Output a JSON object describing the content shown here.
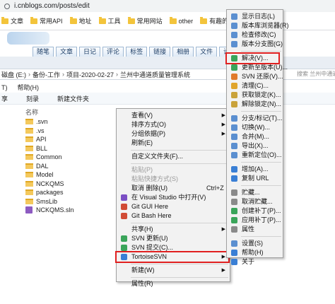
{
  "browser": {
    "url": "i.cnblogs.com/posts/edit",
    "bookmarks": [
      "文章",
      "常用API",
      "地址",
      "工具",
      "常用网站",
      "other",
      "有趣的"
    ]
  },
  "blog": {
    "tabs": [
      "随笔",
      "文章",
      "日记",
      "评论",
      "标签",
      "链接",
      "相册",
      "文件",
      "设置"
    ]
  },
  "explorer": {
    "address": [
      "磁盘 (E:)",
      "备份-工作",
      "项目-2020-02-27",
      "兰州中通道质量管理系统"
    ],
    "search_placeholder": "搜索 兰州中通道",
    "menu": [
      "T)",
      "帮助(H)"
    ],
    "commands": [
      "享",
      "刻录",
      "新建文件夹"
    ],
    "column_name": "名称",
    "column_date": "修",
    "files": [
      {
        "name": ".svn",
        "type": "folder"
      },
      {
        "name": ".vs",
        "type": "folder"
      },
      {
        "name": "API",
        "type": "folder"
      },
      {
        "name": "BLL",
        "type": "folder"
      },
      {
        "name": "Common",
        "type": "folder"
      },
      {
        "name": "DAL",
        "type": "folder"
      },
      {
        "name": "Model",
        "type": "folder"
      },
      {
        "name": "NCKQMS",
        "type": "folder"
      },
      {
        "name": "packages",
        "type": "folder"
      },
      {
        "name": "SmsLib",
        "type": "folder"
      },
      {
        "name": "NCKQMS.sln",
        "type": "sln"
      }
    ]
  },
  "context_menu": {
    "items": [
      {
        "label": "查看(V)",
        "arrow": true
      },
      {
        "label": "排序方式(O)",
        "arrow": true
      },
      {
        "label": "分组依据(P)",
        "arrow": true
      },
      {
        "label": "刷新(E)"
      },
      {
        "sep": true
      },
      {
        "label": "自定义文件夹(F)..."
      },
      {
        "sep": true
      },
      {
        "label": "粘贴(P)",
        "disabled": true
      },
      {
        "label": "粘贴快捷方式(S)",
        "disabled": true
      },
      {
        "label": "取消 删除(U)",
        "shortcut": "Ctrl+Z"
      },
      {
        "label": "在 Visual Studio 中打开(V)",
        "icon": "#7b4fc4"
      },
      {
        "label": "Git GUI Here",
        "icon": "#d14b35"
      },
      {
        "label": "Git Bash Here",
        "icon": "#d14b35"
      },
      {
        "sep": true
      },
      {
        "label": "共享(H)",
        "arrow": true
      },
      {
        "label": "SVN 更新(U)",
        "icon": "#3aa55a"
      },
      {
        "label": "SVN 提交(C)...",
        "icon": "#3aa55a"
      },
      {
        "label": "TortoiseSVN",
        "arrow": true,
        "icon": "#3a7fd5",
        "highlight": true
      },
      {
        "sep": true
      },
      {
        "label": "新建(W)",
        "arrow": true
      },
      {
        "sep": true
      },
      {
        "label": "属性(R)"
      }
    ]
  },
  "svn_submenu": {
    "items": [
      {
        "label": "显示日志(L)",
        "icon": "#5b8fd0"
      },
      {
        "label": "版本库浏览器(R)",
        "icon": "#5b8fd0"
      },
      {
        "label": "检查修改(C)",
        "icon": "#5b8fd0"
      },
      {
        "label": "版本分支图(G)",
        "icon": "#5b8fd0"
      },
      {
        "sep": true
      },
      {
        "label": "解决(V)...",
        "icon": "#3aa55a",
        "highlight": true
      },
      {
        "label": "更新至版本(U)...",
        "icon": "#3aa55a"
      },
      {
        "label": "SVN 还原(V)...",
        "icon": "#e07a2b"
      },
      {
        "label": "清理(C)...",
        "icon": "#e0a42b"
      },
      {
        "label": "获取锁定(K)...",
        "icon": "#c9a23a"
      },
      {
        "label": "解除锁定(N)...",
        "icon": "#c9a23a"
      },
      {
        "sep": true
      },
      {
        "label": "分支/标记(T)...",
        "icon": "#5b8fd0"
      },
      {
        "label": "切换(W)...",
        "icon": "#5b8fd0"
      },
      {
        "label": "合并(M)...",
        "icon": "#5b8fd0"
      },
      {
        "label": "导出(X)...",
        "icon": "#5b8fd0"
      },
      {
        "label": "重新定位(O)...",
        "icon": "#5b8fd0"
      },
      {
        "sep": true
      },
      {
        "label": "增加(A)...",
        "icon": "#3a7fd5"
      },
      {
        "label": "复制 URL",
        "icon": "#3a7fd5"
      },
      {
        "sep": true
      },
      {
        "label": "贮藏...",
        "icon": "#8a8a8a"
      },
      {
        "label": "取消贮藏...",
        "icon": "#8a8a8a"
      },
      {
        "label": "创建补丁(P)...",
        "icon": "#3aa55a"
      },
      {
        "label": "应用补丁(P)...",
        "icon": "#3aa55a"
      },
      {
        "label": "属性",
        "icon": "#8a8a8a"
      },
      {
        "sep": true
      },
      {
        "label": "设置(S)",
        "icon": "#5b8fd0"
      },
      {
        "label": "帮助(H)",
        "icon": "#3a7fd5"
      },
      {
        "label": "关于",
        "icon": "#3a7fd5"
      }
    ]
  }
}
